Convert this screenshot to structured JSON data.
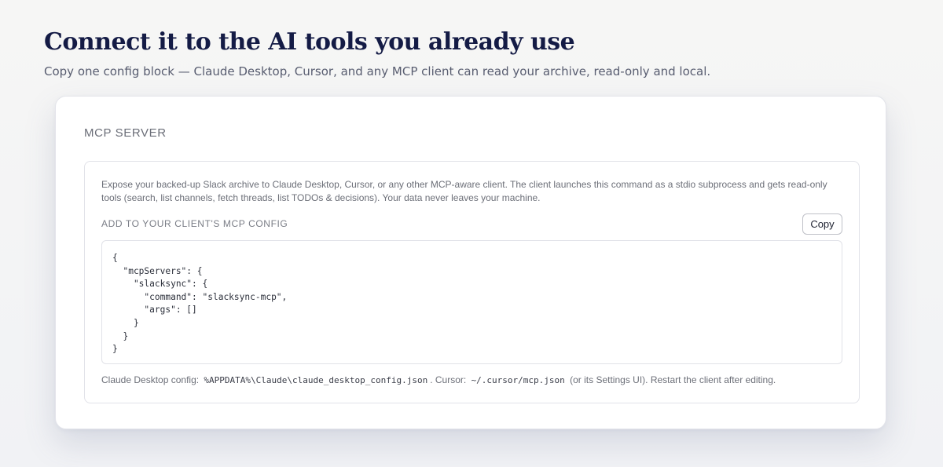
{
  "header": {
    "title": "Connect it to the AI tools you already use",
    "subtitle": "Copy one config block — Claude Desktop, Cursor, and any MCP client can read your archive, read-only and local."
  },
  "card": {
    "heading": "MCP SERVER",
    "description": "Expose your backed-up Slack archive to Claude Desktop, Cursor, or any other MCP-aware client. The client launches this command as a stdio subprocess and gets read-only tools (search, list channels, fetch threads, list TODOs & decisions). Your data never leaves your machine.",
    "config_label": "ADD TO YOUR CLIENT'S MCP CONFIG",
    "copy_label": "Copy",
    "code": "{\n  \"mcpServers\": {\n    \"slacksync\": {\n      \"command\": \"slacksync-mcp\",\n      \"args\": []\n    }\n  }\n}",
    "footer": {
      "claude_prefix": "Claude Desktop config:",
      "claude_path": "%APPDATA%\\Claude\\claude_desktop_config.json",
      "cursor_prefix": ". Cursor:",
      "cursor_path": "~/.cursor/mcp.json",
      "suffix": "(or its Settings UI). Restart the client after editing."
    }
  }
}
